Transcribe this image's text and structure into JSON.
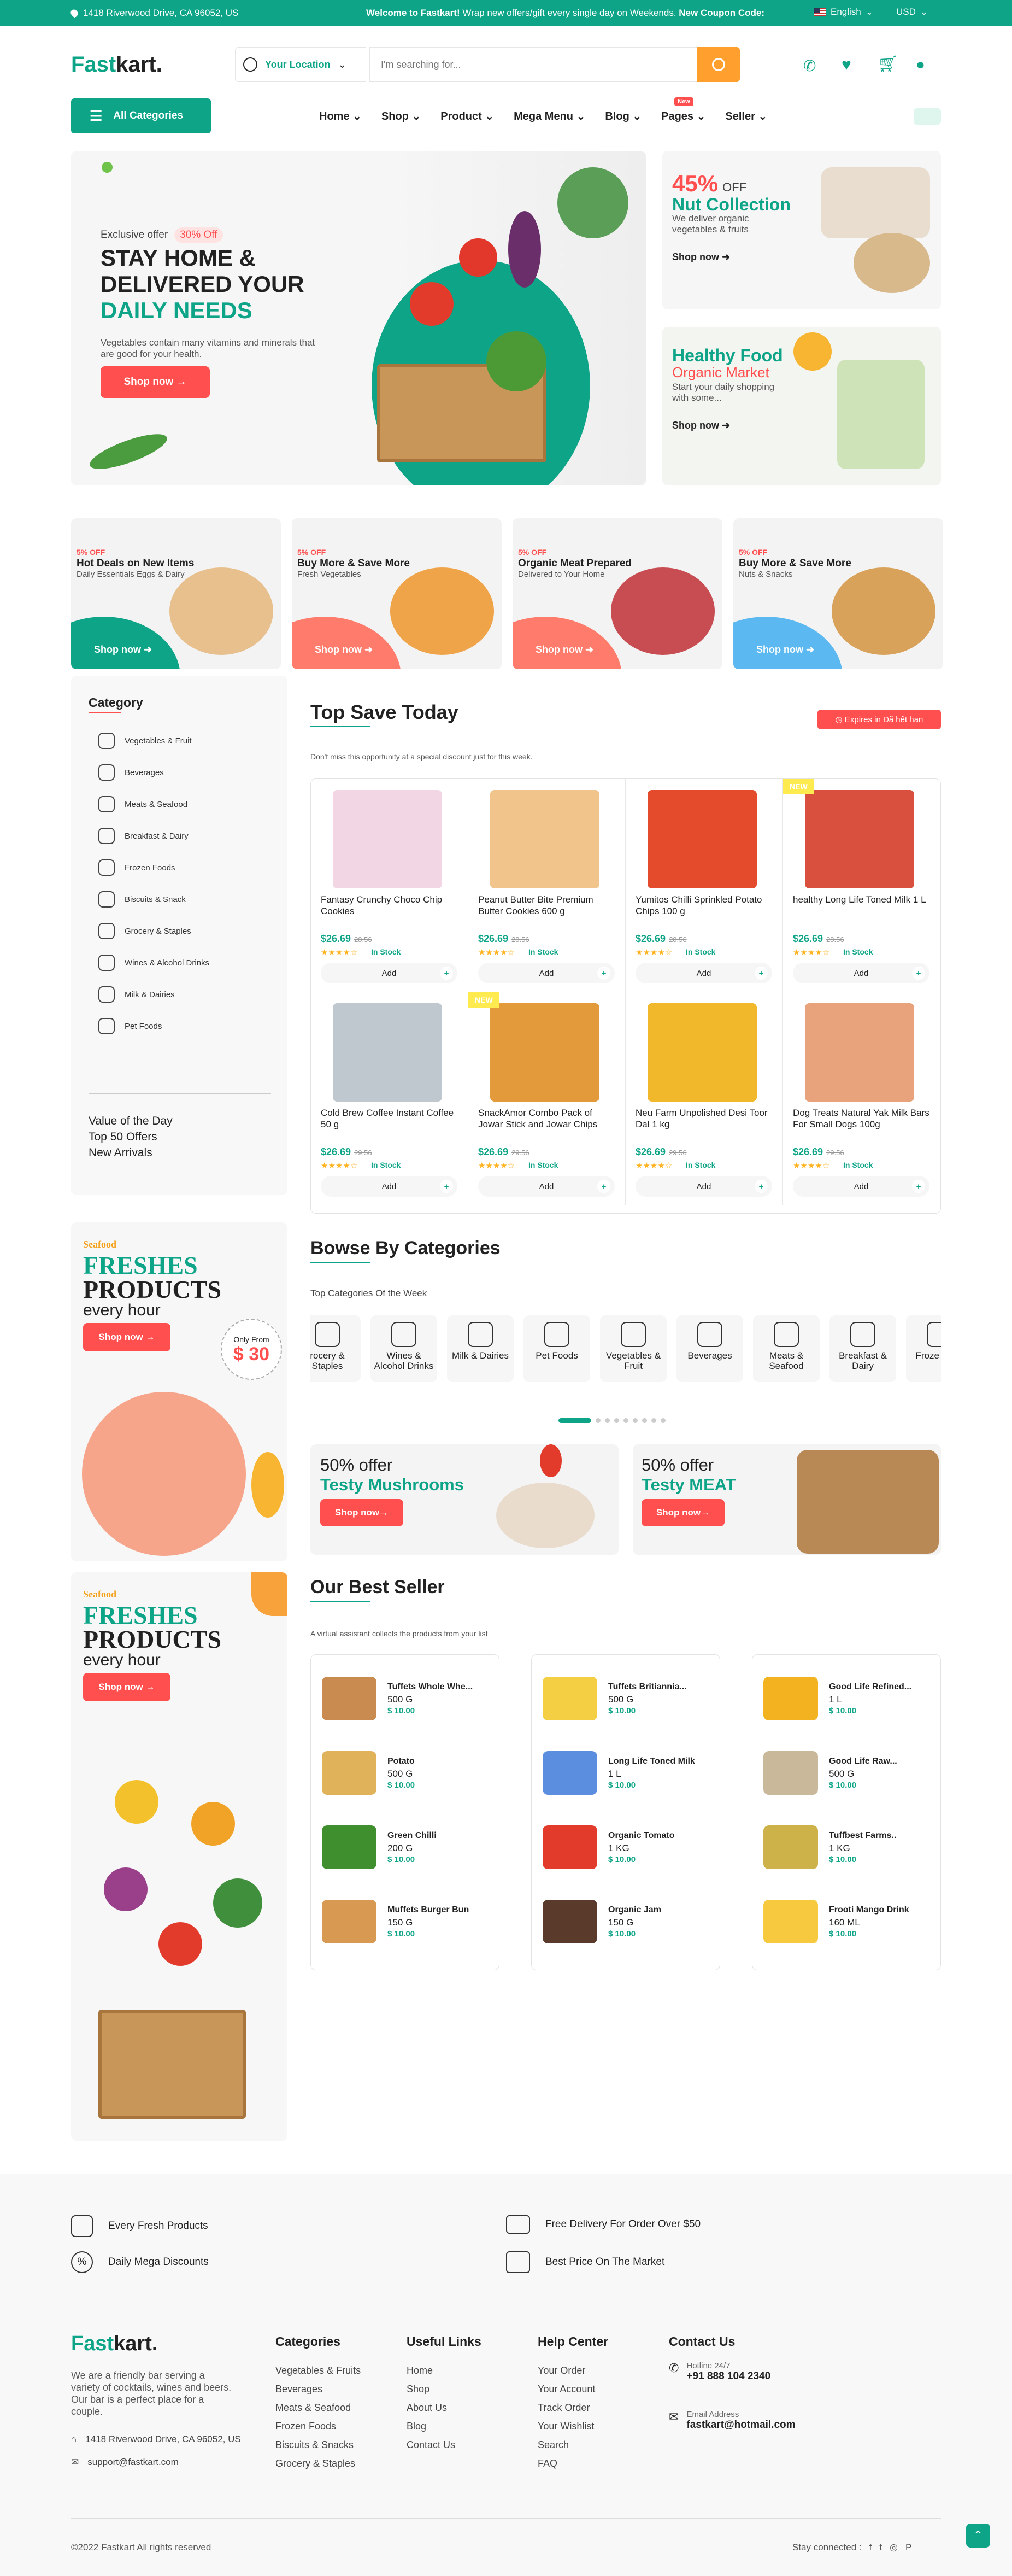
{
  "topbar": {
    "address": "1418 Riverwood Drive, CA 96052, US",
    "promo_bold": "Welcome to Fastkart!",
    "promo_text": " Wrap new offers/gift every single day on Weekends.",
    "coupon": " New Coupon Code: ",
    "language": "English",
    "currency": "USD"
  },
  "header": {
    "logo_main": "Fast",
    "logo_accent": "kart.",
    "location_label": "Your Location",
    "search_placeholder": "I'm searching for...",
    "all_categories": "All Categories",
    "nav": [
      "Home",
      "Shop",
      "Product",
      "Mega Menu",
      "Blog",
      "Pages",
      "Seller"
    ],
    "new_badge": "New"
  },
  "hero": {
    "exclusive": "Exclusive offer",
    "off_badge": "30% Off",
    "line1": "STAY HOME &",
    "line2": "DELIVERED YOUR",
    "line3": "DAILY NEEDS",
    "desc": "Vegetables contain many vitamins and minerals that are good for your health.",
    "cta": "Shop now"
  },
  "side_banners": [
    {
      "pct": "45%",
      "off": "OFF",
      "title": "Nut Collection",
      "desc": "We deliver organic vegetables & fruits",
      "cta": "Shop now"
    },
    {
      "title": "Healthy Food",
      "sub": "Organic Market",
      "desc": "Start your daily shopping with some...",
      "cta": "Shop now"
    }
  ],
  "deals": [
    {
      "off": "5% OFF",
      "title": "Hot Deals on New Items",
      "sub": "Daily Essentials Eggs & Dairy",
      "cta": "Shop now",
      "color": "#0da487"
    },
    {
      "off": "5% OFF",
      "title": "Buy More & Save More",
      "sub": "Fresh Vegetables",
      "cta": "Shop now",
      "color": "#ff7b6b"
    },
    {
      "off": "5% OFF",
      "title": "Organic Meat Prepared",
      "sub": "Delivered to Your Home",
      "cta": "Shop now",
      "color": "#ff7b6b"
    },
    {
      "off": "5% OFF",
      "title": "Buy More & Save More",
      "sub": "Nuts & Snacks",
      "cta": "Shop now",
      "color": "#5cb8f0"
    }
  ],
  "category_sidebar": {
    "title": "Category",
    "items": [
      "Vegetables & Fruit",
      "Beverages",
      "Meats & Seafood",
      "Breakfast & Dairy",
      "Frozen Foods",
      "Biscuits & Snack",
      "Grocery & Staples",
      "Wines & Alcohol Drinks",
      "Milk & Dairies",
      "Pet Foods"
    ],
    "links": [
      "Value of the Day",
      "Top 50 Offers",
      "New Arrivals"
    ]
  },
  "top_save": {
    "title": "Top Save Today",
    "timer": "Expires in Đã hết hạn",
    "subtitle": "Don't miss this opportunity at a special discount just for this week.",
    "add_label": "Add",
    "stock_label": "In Stock",
    "stars": "★★★★☆",
    "products": [
      {
        "name": "Fantasy Crunchy Choco Chip Cookies",
        "price": "$26.69",
        "old": "28.56",
        "color": "#f2d6e4",
        "new": ""
      },
      {
        "name": "Peanut Butter Bite Premium Butter Cookies 600 g",
        "price": "$26.69",
        "old": "28.56",
        "color": "#f0c48a",
        "new": ""
      },
      {
        "name": "Yumitos Chilli Sprinkled Potato Chips 100 g",
        "price": "$26.69",
        "old": "28.56",
        "color": "#e44a2c",
        "new": ""
      },
      {
        "name": "healthy Long Life Toned Milk 1 L",
        "price": "$26.69",
        "old": "28.56",
        "color": "#d9503f",
        "new": "NEW"
      },
      {
        "name": "Cold Brew Coffee Instant Coffee 50 g",
        "price": "$26.69",
        "old": "29.56",
        "color": "#bfc8cf",
        "new": ""
      },
      {
        "name": "SnackAmor Combo Pack of Jowar Stick and Jowar Chips",
        "price": "$26.69",
        "old": "29.56",
        "color": "#e39a3b",
        "new": "NEW"
      },
      {
        "name": "Neu Farm Unpolished Desi Toor Dal 1 kg",
        "price": "$26.69",
        "old": "29.56",
        "color": "#f2b82b",
        "new": ""
      },
      {
        "name": "Dog Treats Natural Yak Milk Bars For Small Dogs 100g",
        "price": "$26.69",
        "old": "29.56",
        "color": "#e9a37c",
        "new": ""
      }
    ]
  },
  "promo_left_1": {
    "tag": "Seafood",
    "line1": "FRESHES",
    "line2": "PRODUCTS",
    "line3": "every hour",
    "cta": "Shop now",
    "from": "Only From",
    "price": "$ 30"
  },
  "promo_left_2": {
    "tag": "Seafood",
    "line1": "FRESHES",
    "line2": "PRODUCTS",
    "line3": "every hour",
    "cta": "Shop now"
  },
  "browse": {
    "title": "Bowse By Categories",
    "subtitle": "Top Categories Of the Week",
    "tiles": [
      "rocery & Staples",
      "Wines & Alcohol Drinks",
      "Milk & Dairies",
      "Pet Foods",
      "Vegetables & Fruit",
      "Beverages",
      "Meats & Seafood",
      "Breakfast & Dairy",
      "Froze Food"
    ]
  },
  "offers": [
    {
      "pct": "50% offer",
      "title": "Testy Mushrooms",
      "cta": "Shop now"
    },
    {
      "pct": "50% offer",
      "title": "Testy MEAT",
      "cta": "Shop now"
    }
  ],
  "best_seller": {
    "title": "Our Best Seller",
    "subtitle": "A virtual assistant collects the products from your list",
    "columns": [
      [
        {
          "name": "Tuffets Whole Whe...",
          "w": "500 G",
          "p": "$ 10.00",
          "color": "#c98b4f"
        },
        {
          "name": "Potato",
          "w": "500 G",
          "p": "$ 10.00",
          "color": "#e0b25a"
        },
        {
          "name": "Green Chilli",
          "w": "200 G",
          "p": "$ 10.00",
          "color": "#3f8f2f"
        },
        {
          "name": "Muffets Burger Bun",
          "w": "150 G",
          "p": "$ 10.00",
          "color": "#d89a52"
        }
      ],
      [
        {
          "name": "Tuffets Britiannia...",
          "w": "500 G",
          "p": "$ 10.00",
          "color": "#f4cf44"
        },
        {
          "name": "Long Life Toned Milk",
          "w": "1 L",
          "p": "$ 10.00",
          "color": "#5c8ee0"
        },
        {
          "name": "Organic Tomato",
          "w": "1 KG",
          "p": "$ 10.00",
          "color": "#e23b2b"
        },
        {
          "name": "Organic Jam",
          "w": "150 G",
          "p": "$ 10.00",
          "color": "#5a3a2a"
        }
      ],
      [
        {
          "name": "Good Life Refined...",
          "w": "1 L",
          "p": "$ 10.00",
          "color": "#f3b21f"
        },
        {
          "name": "Good Life Raw...",
          "w": "500 G",
          "p": "$ 10.00",
          "color": "#c9b89a"
        },
        {
          "name": "Tuffbest Farms..",
          "w": "1 KG",
          "p": "$ 10.00",
          "color": "#cdb24a"
        },
        {
          "name": "Frooti Mango Drink",
          "w": "160 ML",
          "p": "$ 10.00",
          "color": "#f6c93e"
        }
      ]
    ]
  },
  "features": [
    "Every Fresh Products",
    "Free Delivery For Order Over $50",
    "Daily Mega Discounts",
    "Best Price On The Market"
  ],
  "footer": {
    "about": "We are a friendly bar serving a variety of cocktails, wines and beers. Our bar is a perfect place for a couple.",
    "address": "1418 Riverwood Drive, CA 96052, US",
    "email": "support@fastkart.com",
    "categories_title": "Categories",
    "categories": [
      "Vegetables & Fruits",
      "Beverages",
      "Meats & Seafood",
      "Frozen Foods",
      "Biscuits & Snacks",
      "Grocery & Staples"
    ],
    "useful_title": "Useful Links",
    "useful": [
      "Home",
      "Shop",
      "About Us",
      "Blog",
      "Contact Us"
    ],
    "help_title": "Help Center",
    "help": [
      "Your Order",
      "Your Account",
      "Track Order",
      "Your Wishlist",
      "Search",
      "FAQ"
    ],
    "contact_title": "Contact Us",
    "hotline_label": "Hotline 24/7",
    "hotline": "+91 888 104 2340",
    "email_label": "Email Address",
    "email2": "fastkart@hotmail.com",
    "copyright": "©2022 Fastkart All rights reserved",
    "stay": "Stay connected :",
    "social": [
      "f",
      "t",
      "◎",
      "P"
    ]
  }
}
